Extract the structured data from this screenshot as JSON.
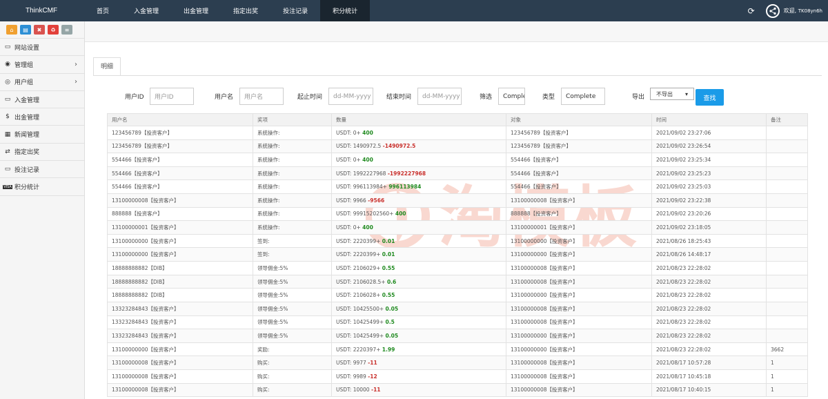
{
  "app": {
    "brand": "ThinkCMF"
  },
  "nav": [
    {
      "label": "首页",
      "active": false
    },
    {
      "label": "入金管理",
      "active": false
    },
    {
      "label": "出金管理",
      "active": false
    },
    {
      "label": "指定出奖",
      "active": false
    },
    {
      "label": "投注记录",
      "active": false
    },
    {
      "label": "积分统计",
      "active": true
    }
  ],
  "header": {
    "welcome": "欢迎,",
    "username": "TK08yn6h"
  },
  "quick_buttons": [
    {
      "icon": "home-icon",
      "color": "#f0a030",
      "glyph": "⌂"
    },
    {
      "icon": "file-icon",
      "color": "#2d8fd5",
      "glyph": "▤"
    },
    {
      "icon": "trash-icon",
      "color": "#d9534f",
      "glyph": "✖"
    },
    {
      "icon": "recycle-icon",
      "color": "#e2403a",
      "glyph": "♻"
    },
    {
      "icon": "list-icon",
      "color": "#95a5a6",
      "glyph": "≡"
    }
  ],
  "sidebar": [
    {
      "label": "网站设置",
      "icon": "monitor-icon",
      "glyph": "▭",
      "arrow": false
    },
    {
      "label": "管理组",
      "icon": "user-circle-icon",
      "glyph": "◉",
      "arrow": true
    },
    {
      "label": "用户组",
      "icon": "user-icon",
      "glyph": "◎",
      "arrow": true
    },
    {
      "label": "入金管理",
      "icon": "monitor-icon",
      "glyph": "▭",
      "arrow": false
    },
    {
      "label": "出金管理",
      "icon": "dollar-icon",
      "glyph": "$",
      "arrow": false
    },
    {
      "label": "新闻管理",
      "icon": "newspaper-icon",
      "glyph": "▦",
      "arrow": false
    },
    {
      "label": "指定出奖",
      "icon": "exchange-icon",
      "glyph": "⇄",
      "arrow": false
    },
    {
      "label": "投注记录",
      "icon": "monitor-icon",
      "glyph": "▭",
      "arrow": false
    },
    {
      "label": "积分统计",
      "icon": "visa-card-icon",
      "glyph": "VISA",
      "arrow": false
    }
  ],
  "tab": {
    "label": "明细"
  },
  "filters": {
    "user_id_label": "用户ID",
    "user_id_placeholder": "用户ID",
    "username_label": "用户名",
    "username_placeholder": "用户名",
    "start_label": "起止时间",
    "start_placeholder": "dd-MM-yyyy",
    "end_label": "结束时间",
    "end_placeholder": "dd-MM-yyyy",
    "filter_label": "筛选",
    "filter_value": "Comple",
    "type_label": "类型",
    "type_value": "Complete",
    "export_label": "导出",
    "export_value": "不导出",
    "search_button": "查找"
  },
  "table": {
    "columns": [
      "用户名",
      "奖项",
      "数量",
      "对象",
      "时间",
      "备注"
    ],
    "rows": [
      {
        "user": "123456789【投资客户】",
        "item": "系统操作:",
        "qty_prefix": "USDT: 0+",
        "qty_value": "400",
        "qty_sign": "pos",
        "target": "123456789【投资客户】",
        "time": "2021/09/02 23:27:06",
        "note": ""
      },
      {
        "user": "123456789【投资客户】",
        "item": "系统操作:",
        "qty_prefix": "USDT: 1490972.5",
        "qty_value": "-1490972.5",
        "qty_sign": "neg",
        "target": "123456789【投资客户】",
        "time": "2021/09/02 23:26:54",
        "note": ""
      },
      {
        "user": "554466【投资客户】",
        "item": "系统操作:",
        "qty_prefix": "USDT: 0+",
        "qty_value": "400",
        "qty_sign": "pos",
        "target": "554466【投资客户】",
        "time": "2021/09/02 23:25:34",
        "note": ""
      },
      {
        "user": "554466【投资客户】",
        "item": "系统操作:",
        "qty_prefix": "USDT: 1992227968",
        "qty_value": "-1992227968",
        "qty_sign": "neg",
        "target": "554466【投资客户】",
        "time": "2021/09/02 23:25:23",
        "note": ""
      },
      {
        "user": "554466【投资客户】",
        "item": "系统操作:",
        "qty_prefix": "USDT: 996113984+",
        "qty_value": "996113984",
        "qty_sign": "pos",
        "target": "554466【投资客户】",
        "time": "2021/09/02 23:25:03",
        "note": ""
      },
      {
        "user": "13100000008【投资客户】",
        "item": "系统操作:",
        "qty_prefix": "USDT: 9966",
        "qty_value": "-9566",
        "qty_sign": "neg",
        "target": "13100000008【投资客户】",
        "time": "2021/09/02 23:22:38",
        "note": ""
      },
      {
        "user": "888888【投资客户】",
        "item": "系统操作:",
        "qty_prefix": "USDT: 99915202560+",
        "qty_value": "400",
        "qty_sign": "pos",
        "target": "888888【投资客户】",
        "time": "2021/09/02 23:20:26",
        "note": ""
      },
      {
        "user": "13100000001【投资客户】",
        "item": "系统操作:",
        "qty_prefix": "USDT: 0+",
        "qty_value": "400",
        "qty_sign": "pos",
        "target": "13100000001【投资客户】",
        "time": "2021/09/02 23:18:05",
        "note": ""
      },
      {
        "user": "13100000000【投资客户】",
        "item": "签到:",
        "qty_prefix": "USDT: 2220399+",
        "qty_value": "0.01",
        "qty_sign": "pos",
        "target": "13100000000【投资客户】",
        "time": "2021/08/26 18:25:43",
        "note": ""
      },
      {
        "user": "13100000000【投资客户】",
        "item": "签到:",
        "qty_prefix": "USDT: 2220399+",
        "qty_value": "0.01",
        "qty_sign": "pos",
        "target": "13100000000【投资客户】",
        "time": "2021/08/26 14:48:17",
        "note": ""
      },
      {
        "user": "18888888882【DIB】",
        "item": "领导佣金:5%",
        "qty_prefix": "USDT: 2106029+",
        "qty_value": "0.55",
        "qty_sign": "pos",
        "target": "13100000008【投资客户】",
        "time": "2021/08/23 22:28:02",
        "note": ""
      },
      {
        "user": "18888888882【DIB】",
        "item": "领导佣金:5%",
        "qty_prefix": "USDT: 2106028.5+",
        "qty_value": "0.6",
        "qty_sign": "pos",
        "target": "13100000008【投资客户】",
        "time": "2021/08/23 22:28:02",
        "note": ""
      },
      {
        "user": "18888888882【DIB】",
        "item": "领导佣金:5%",
        "qty_prefix": "USDT: 2106028+",
        "qty_value": "0.55",
        "qty_sign": "pos",
        "target": "13100000000【投资客户】",
        "time": "2021/08/23 22:28:02",
        "note": ""
      },
      {
        "user": "13323284843【投资客户】",
        "item": "领导佣金:5%",
        "qty_prefix": "USDT: 10425500+",
        "qty_value": "0.05",
        "qty_sign": "pos",
        "target": "13100000008【投资客户】",
        "time": "2021/08/23 22:28:02",
        "note": ""
      },
      {
        "user": "13323284843【投资客户】",
        "item": "领导佣金:5%",
        "qty_prefix": "USDT: 10425499+",
        "qty_value": "0.5",
        "qty_sign": "pos",
        "target": "13100000008【投资客户】",
        "time": "2021/08/23 22:28:02",
        "note": ""
      },
      {
        "user": "13323284843【投资客户】",
        "item": "领导佣金:5%",
        "qty_prefix": "USDT: 10425499+",
        "qty_value": "0.05",
        "qty_sign": "pos",
        "target": "13100000000【投资客户】",
        "time": "2021/08/23 22:28:02",
        "note": ""
      },
      {
        "user": "13100000000【投资客户】",
        "item": "奖励:",
        "qty_prefix": "USDT: 2220397+",
        "qty_value": "1.99",
        "qty_sign": "pos",
        "target": "13100000000【投资客户】",
        "time": "2021/08/23 22:28:02",
        "note": "3662"
      },
      {
        "user": "13100000008【投资客户】",
        "item": "购买:",
        "qty_prefix": "USDT: 9977",
        "qty_value": "-11",
        "qty_sign": "neg",
        "target": "13100000008【投资客户】",
        "time": "2021/08/17 10:57:28",
        "note": "1"
      },
      {
        "user": "13100000008【投资客户】",
        "item": "购买:",
        "qty_prefix": "USDT: 9989",
        "qty_value": "-12",
        "qty_sign": "neg",
        "target": "13100000008【投资客户】",
        "time": "2021/08/17 10:45:18",
        "note": "1"
      },
      {
        "user": "13100000008【投资客户】",
        "item": "购买:",
        "qty_prefix": "USDT: 10000",
        "qty_value": "-11",
        "qty_sign": "neg",
        "target": "13100000008【投资客户】",
        "time": "2021/08/17 10:40:15",
        "note": "1"
      }
    ]
  },
  "watermark": {
    "text": "淘模板"
  }
}
